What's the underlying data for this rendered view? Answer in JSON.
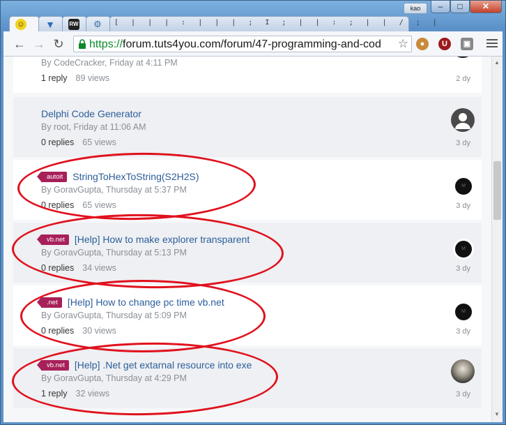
{
  "window": {
    "user_label": "kao",
    "min_symbol": "–",
    "max_symbol": "□",
    "close_symbol": "✕"
  },
  "tabs": [
    {
      "icon": "smiley-icon",
      "label": ""
    },
    {
      "icon": "bookmark-icon",
      "label": ""
    },
    {
      "icon": "rw-icon",
      "label": "RW"
    },
    {
      "icon": "gear-icon",
      "label": ""
    },
    {
      "icon": "page-icon",
      "label": "[ | | | : | | | ; I ; | | : ; | | / ; |"
    }
  ],
  "toolbar": {
    "url_scheme": "https://",
    "url_rest": "forum.tuts4you.com/forum/47-programming-and-cod",
    "ext1": "●",
    "ext2": "U",
    "ext3": "▣"
  },
  "topics": [
    {
      "title": "",
      "tag": "",
      "author_line": "By CodeCracker, Friday at 4:11 PM",
      "replies": "1 reply",
      "views": "89 views",
      "age": "2 dy",
      "avatar": "dark"
    },
    {
      "title": "Delphi Code Generator",
      "tag": "",
      "author_line": "By root, Friday at 11:06 AM",
      "replies": "0 replies",
      "views": "65 views",
      "age": "3 dy",
      "avatar": "default"
    },
    {
      "title": "StringToHexToString(S2H2S)",
      "tag": "autoit",
      "author_line": "By GoravGupta, Thursday at 5:37 PM",
      "replies": "0 replies",
      "views": "65 views",
      "age": "3 dy",
      "avatar": "M"
    },
    {
      "title": "[Help] How to make explorer transparent",
      "tag": "vb.net",
      "author_line": "By GoravGupta, Thursday at 5:13 PM",
      "replies": "0 replies",
      "views": "34 views",
      "age": "3 dy",
      "avatar": "M"
    },
    {
      "title": "[Help] How to change pc time vb.net",
      "tag": ".net",
      "author_line": "By GoravGupta, Thursday at 5:09 PM",
      "replies": "0 replies",
      "views": "30 views",
      "age": "3 dy",
      "avatar": "M"
    },
    {
      "title": "[Help] .Net get extarnal resource into exe",
      "tag": "vb.net",
      "author_line": "By GoravGupta, Thursday at 4:29 PM",
      "replies": "1 reply",
      "views": "32 views",
      "age": "3 dy",
      "avatar": "photo"
    }
  ],
  "colors": {
    "link": "#2c5e9a",
    "tag": "#a8205a",
    "annotation": "#e0111d",
    "https": "#0a8a2a"
  }
}
